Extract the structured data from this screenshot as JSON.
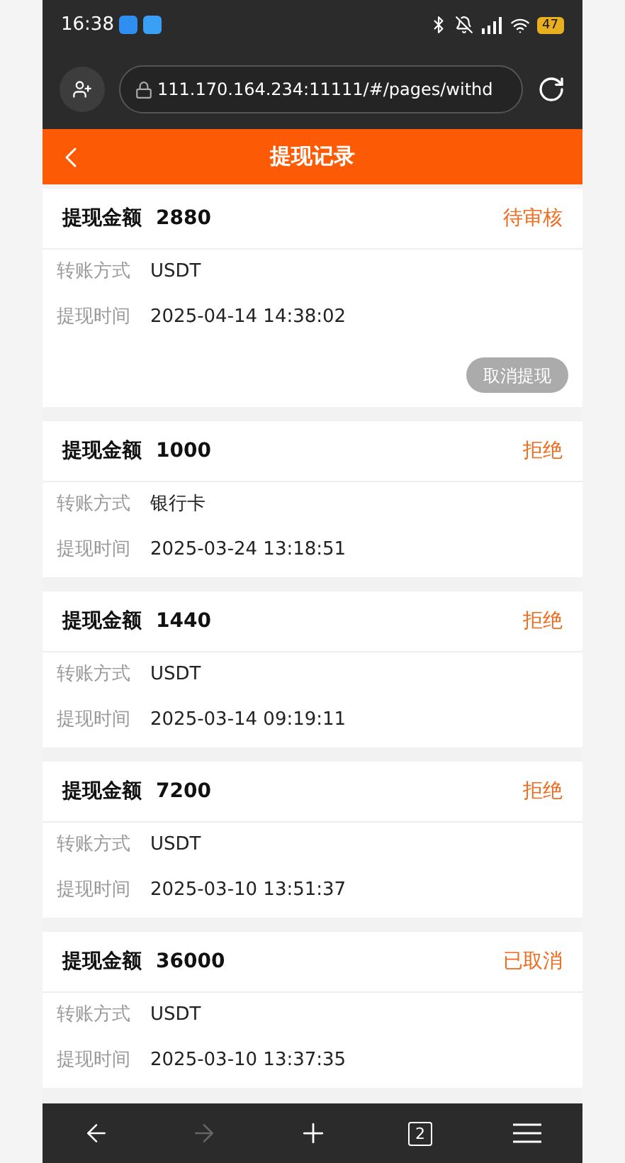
{
  "status_bar": {
    "time": "16:38",
    "battery": "47"
  },
  "browser": {
    "url": "111.170.164.234:11111/#/pages/withd",
    "tab_count": "2",
    "forward_disabled": true
  },
  "header": {
    "title": "提现记录"
  },
  "records": [
    {
      "amount_label": "提现金额",
      "amount": "2880",
      "status": "待审核",
      "method_label": "转账方式",
      "method": "USDT",
      "time_label": "提现时间",
      "time": "2025-04-14 14:38:02",
      "cancel_button": {
        "label": "取消提现",
        "disabled": true
      }
    },
    {
      "amount_label": "提现金额",
      "amount": "1000",
      "status": "拒绝",
      "method_label": "转账方式",
      "method": "银行卡",
      "time_label": "提现时间",
      "time": "2025-03-24 13:18:51"
    },
    {
      "amount_label": "提现金额",
      "amount": "1440",
      "status": "拒绝",
      "method_label": "转账方式",
      "method": "USDT",
      "time_label": "提现时间",
      "time": "2025-03-14 09:19:11"
    },
    {
      "amount_label": "提现金额",
      "amount": "7200",
      "status": "拒绝",
      "method_label": "转账方式",
      "method": "USDT",
      "time_label": "提现时间",
      "time": "2025-03-10 13:51:37"
    },
    {
      "amount_label": "提现金额",
      "amount": "36000",
      "status": "已取消",
      "method_label": "转账方式",
      "method": "USDT",
      "time_label": "提现时间",
      "time": "2025-03-10 13:37:35"
    }
  ]
}
